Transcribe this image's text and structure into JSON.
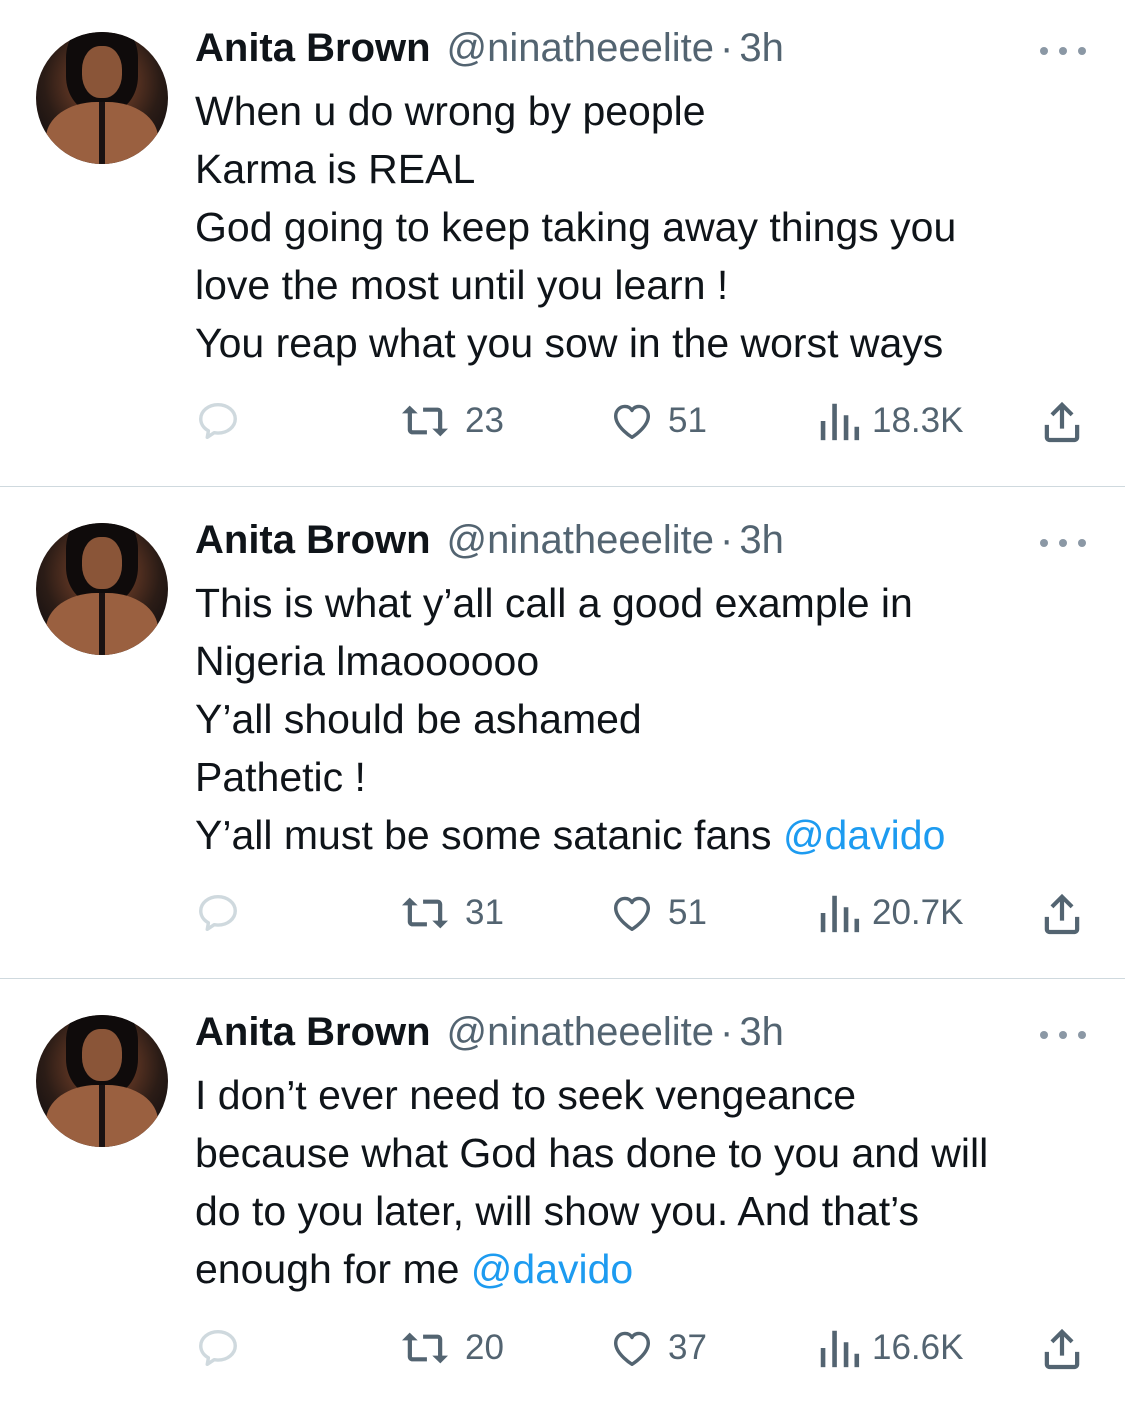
{
  "tweets": [
    {
      "name": "Anita Brown",
      "handle": "@ninatheeelite",
      "separator": "·",
      "time": "3h",
      "lines": [
        {
          "text": "When u do wrong by people",
          "mention": ""
        },
        {
          "text": "Karma is REAL",
          "mention": ""
        },
        {
          "text": "God going to keep taking away things you",
          "mention": ""
        },
        {
          "text": "love the most until you learn !",
          "mention": ""
        },
        {
          "text": "You reap what you sow in the worst ways",
          "mention": ""
        }
      ],
      "retweets": "23",
      "likes": "51",
      "views": "18.3K"
    },
    {
      "name": "Anita Brown",
      "handle": "@ninatheeelite",
      "separator": "·",
      "time": "3h",
      "lines": [
        {
          "text": "This is what y’all call a good example in",
          "mention": ""
        },
        {
          "text": "Nigeria lmaoooooo",
          "mention": ""
        },
        {
          "text": "Y’all should be ashamed",
          "mention": ""
        },
        {
          "text": "Pathetic !",
          "mention": ""
        },
        {
          "text": "Y’all must be some satanic fans ",
          "mention": "@davido"
        }
      ],
      "retweets": "31",
      "likes": "51",
      "views": "20.7K"
    },
    {
      "name": "Anita Brown",
      "handle": "@ninatheeelite",
      "separator": "·",
      "time": "3h",
      "lines": [
        {
          "text": "I don’t ever need to seek vengeance",
          "mention": ""
        },
        {
          "text": "because what God has done to you and will",
          "mention": ""
        },
        {
          "text": "do to you later, will show you. And that’s",
          "mention": ""
        },
        {
          "text": "enough for me ",
          "mention": "@davido"
        }
      ],
      "retweets": "20",
      "likes": "37",
      "views": "16.6K"
    }
  ],
  "icons": {
    "reply": "reply-icon",
    "retweet": "retweet-icon",
    "like": "heart-icon",
    "views": "views-icon",
    "share": "share-icon",
    "more": "more-icon"
  },
  "colors": {
    "text": "#0f1419",
    "secondary": "#536471",
    "mention": "#1d9bf0",
    "divider": "#cfd9de",
    "reply_icon": "#cfd9de"
  }
}
